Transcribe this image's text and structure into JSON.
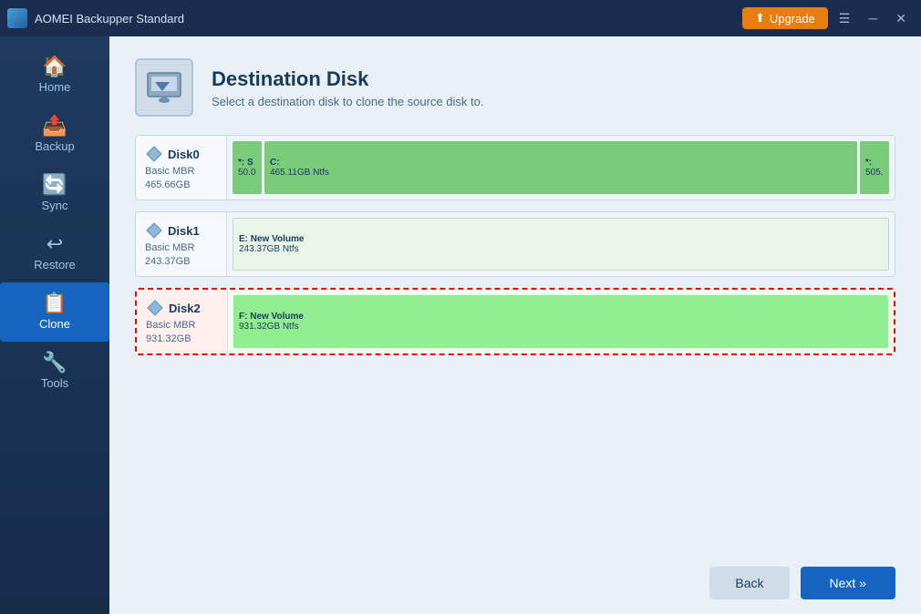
{
  "app": {
    "title": "AOMEI Backupper Standard",
    "upgrade_label": "Upgrade"
  },
  "titlebar": {
    "menu_icon": "☰",
    "minimize_icon": "─",
    "close_icon": "✕"
  },
  "sidebar": {
    "items": [
      {
        "id": "home",
        "label": "Home",
        "icon": "🏠"
      },
      {
        "id": "backup",
        "label": "Backup",
        "icon": "📤"
      },
      {
        "id": "sync",
        "label": "Sync",
        "icon": "🔄"
      },
      {
        "id": "restore",
        "label": "Restore",
        "icon": "↩"
      },
      {
        "id": "clone",
        "label": "Clone",
        "icon": "📋",
        "active": true
      },
      {
        "id": "tools",
        "label": "Tools",
        "icon": "🔧"
      }
    ]
  },
  "page": {
    "title": "Destination Disk",
    "subtitle": "Select a destination disk to clone the source disk to."
  },
  "disks": [
    {
      "id": "disk0",
      "name": "Disk0",
      "type": "Basic MBR",
      "size": "465.66GB",
      "selected": false,
      "partitions": [
        {
          "label": "*: S",
          "size": "50.0",
          "color": "#7acc7a",
          "flex": "0 0 36px"
        },
        {
          "label": "C:",
          "size": "465.11GB Ntfs",
          "color": "#7acc7a",
          "flex": "1"
        },
        {
          "label": "*:",
          "size": "505.",
          "color": "#7acc7a",
          "flex": "0 0 36px"
        }
      ]
    },
    {
      "id": "disk1",
      "name": "Disk1",
      "type": "Basic MBR",
      "size": "243.37GB",
      "selected": false,
      "partitions": [
        {
          "label": "E: New Volume",
          "size": "243.37GB Ntfs",
          "color": "#e8f5e8",
          "flex": "1",
          "border": true
        }
      ]
    },
    {
      "id": "disk2",
      "name": "Disk2",
      "type": "Basic MBR",
      "size": "931.32GB",
      "selected": true,
      "partitions": [
        {
          "label": "F: New Volume",
          "size": "931.32GB Ntfs",
          "color": "#90ee90",
          "flex": "1"
        }
      ]
    }
  ],
  "buttons": {
    "back_label": "Back",
    "next_label": "Next »"
  }
}
